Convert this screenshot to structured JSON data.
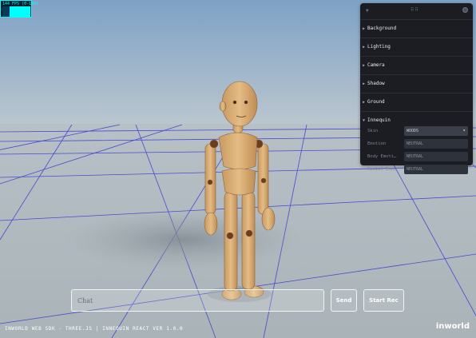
{
  "fps": {
    "label": "144 FPS (0-144)"
  },
  "panel": {
    "folders": [
      {
        "title": "Background"
      },
      {
        "title": "Lighting"
      },
      {
        "title": "Camera"
      },
      {
        "title": "Shadow"
      },
      {
        "title": "Ground"
      }
    ],
    "innequin": {
      "title": "Innequin",
      "rows": [
        {
          "label": "Skin",
          "value": "WOODS"
        },
        {
          "label": "Emotion",
          "value": "NEUTRAL"
        },
        {
          "label": "Body Emoti…",
          "value": "NEUTRAL"
        },
        {
          "label": "Facial Emo…",
          "value": "NEUTRAL"
        }
      ]
    }
  },
  "chat": {
    "placeholder": "Chat"
  },
  "buttons": {
    "send": "Send",
    "start_rec": "Start Rec"
  },
  "footer": {
    "text": "INWORLD WEB SDK - THREE.JS | INNEQUIN REACT VER 1.0.0"
  },
  "logo": {
    "text": "inworld"
  },
  "colors": {
    "grid": "#3b3fd0",
    "panel_bg": "#1b1d23",
    "accent_fps": "#00ffff"
  }
}
